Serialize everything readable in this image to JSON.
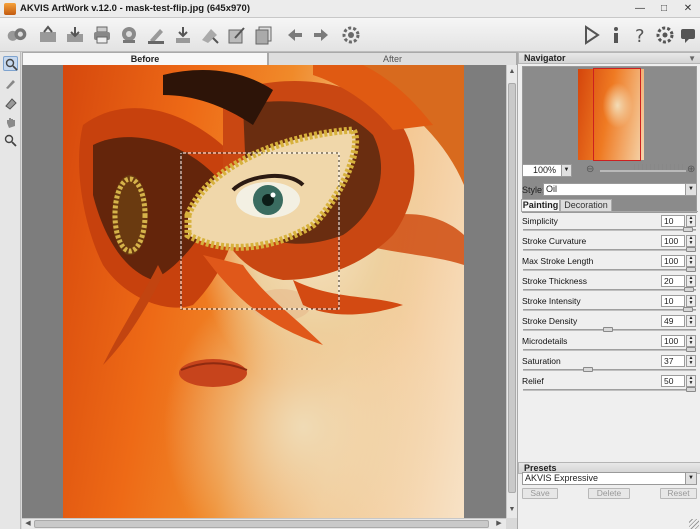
{
  "window": {
    "title": "AKVIS ArtWork v.12.0 - mask-test-flip.jpg (645x970)",
    "icon": "akvis-app-icon",
    "controls": [
      "minimize-icon",
      "maximize-icon",
      "close-icon"
    ]
  },
  "toolbar": {
    "left_buttons": [
      "open-image-icon",
      "save-image-icon",
      "print-icon",
      "share-icon",
      "load-stroke-icon",
      "save-stroke-icon",
      "load-mask-icon",
      "save-mask-icon",
      "batch-icon",
      "undo-arrow-icon",
      "redo-arrow-icon",
      "preferences-gear-icon"
    ],
    "right_buttons": [
      "run-play-icon",
      "info-icon",
      "help-icon",
      "settings-gear-icon",
      "chat-bubble-icon"
    ]
  },
  "tools": [
    "zoom-nav-tool-icon",
    "brush-tool-icon",
    "eraser-tool-icon",
    "hand-tool-icon",
    "magnifier-tool-icon"
  ],
  "view_tabs": {
    "before": "Before",
    "after": "After",
    "active": "before"
  },
  "navigator": {
    "header": "Navigator",
    "zoom": "100%"
  },
  "style": {
    "label": "Style:",
    "value": "Oil"
  },
  "param_tabs": {
    "painting": "Painting",
    "decoration": "Decoration",
    "active": "painting"
  },
  "params": [
    {
      "label": "Simplicity",
      "value": "10",
      "level": 0.98
    },
    {
      "label": "Stroke Curvature",
      "value": "100",
      "level": 1.0
    },
    {
      "label": "Max Stroke Length",
      "value": "100",
      "level": 1.0
    },
    {
      "label": "Stroke Thickness",
      "value": "20",
      "level": 0.99
    },
    {
      "label": "Stroke Intensity",
      "value": "10",
      "level": 0.98
    },
    {
      "label": "Stroke Density",
      "value": "49",
      "level": 0.49
    },
    {
      "label": "Microdetails",
      "value": "100",
      "level": 1.0
    },
    {
      "label": "Saturation",
      "value": "37",
      "level": 0.37
    },
    {
      "label": "Relief",
      "value": "50",
      "level": 1.0
    }
  ],
  "presets": {
    "header": "Presets",
    "selected": "AKVIS Expressive",
    "save": "Save",
    "delete": "Delete",
    "reset": "Reset"
  },
  "colors": {
    "accent_selection": "#c6d8ee",
    "canvas_bg": "#7d7d7d",
    "navigator_frame": "#cc2020"
  }
}
